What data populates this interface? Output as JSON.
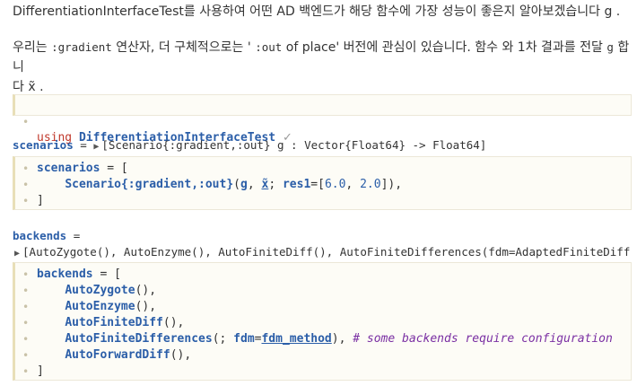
{
  "text": {
    "p1": "DifferentiationInterfaceTest를 사용하여 어떤 AD 백엔드가 해당 함수에 가장 성능이 좋은지 알아보겠습니다  g .",
    "p2_a": "우리는 ",
    "p2_code1": ":gradient",
    "p2_b": " 연산자, 더 구체적으로는 ' ",
    "p2_code2": ":out",
    "p2_c": " of place' 버전에 관심이 있습니다. 함수 와 1차 결과를 전달  ",
    "p2_code3": "g",
    "p2_d": " 합니",
    "p3": "다  x̃ ."
  },
  "cell_using": {
    "kw": "using",
    "mod": "DifferentiationInterfaceTest",
    "status": "✓"
  },
  "scenarios_out": {
    "var": "scenarios",
    "eq": " = ",
    "value": "[Scenario{:gradient,:out} g : Vector{Float64} -> Float64]"
  },
  "cell_scenarios": {
    "l1_id": "scenarios",
    "l1_rest": " = [",
    "l2_type": "Scenario",
    "l2_sym": "{:gradient,:out}",
    "l2_p1": "(",
    "l2_g": "g",
    "l2_c": ", ",
    "l2_x": "x̃",
    "l2_semi": "; ",
    "l2_kw": "res1",
    "l2_eq": "=[",
    "l2_n1": "6.0",
    "l2_cm": ", ",
    "l2_n2": "2.0",
    "l2_end": "]),",
    "l3": "]"
  },
  "backends_out": {
    "var": "backends",
    "eq": " =",
    "value": "[AutoZygote(), AutoEnzyme(), AutoFiniteDiff(), AutoFiniteDifferences(fdm=AdaptedFiniteDiff"
  },
  "cell_backends": {
    "l1_id": "backends",
    "l1_rest": " = [",
    "b1": "AutoZygote",
    "b2": "AutoEnzyme",
    "b3": "AutoFiniteDiff",
    "b4": "AutoFiniteDifferences",
    "b4_kw": "fdm",
    "b4_val": "fdm_method",
    "comment": "# some backends require configuration",
    "b5": "AutoForwardDiff",
    "close": "]"
  }
}
